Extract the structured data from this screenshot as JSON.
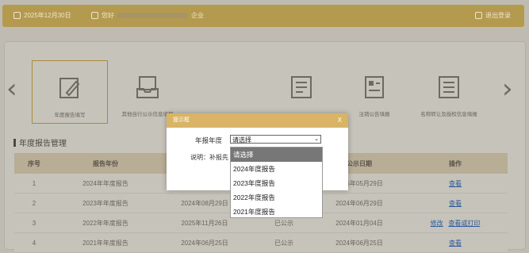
{
  "topbar": {
    "date": "2025年12月30日",
    "welcome": "您好",
    "suffix": "企业",
    "logout": "退出登录"
  },
  "tiles": [
    {
      "label": "年度报告填写"
    },
    {
      "label": "其他自行公示信息填报"
    },
    {
      "label": ""
    },
    {
      "label": "注销公告填报"
    },
    {
      "label": "名称转让及授权信息填报"
    }
  ],
  "section_title": "年度报告管理",
  "table": {
    "headers": [
      "序号",
      "报告年份",
      "",
      "",
      "公示日期",
      "操作"
    ],
    "rows": [
      {
        "num": "1",
        "year": "2024年年度报告",
        "date": "",
        "status": "",
        "pub": "2025年05月29日",
        "edit": "",
        "action": "查看"
      },
      {
        "num": "2",
        "year": "2023年年度报告",
        "date": "2024年08月29日",
        "status": "",
        "pub": "2024年06月29日",
        "edit": "",
        "action": "查看"
      },
      {
        "num": "3",
        "year": "2022年年度报告",
        "date": "2025年11月26日",
        "status": "已公示",
        "pub": "2024年01月04日",
        "edit": "修改",
        "action": "查看或打印"
      },
      {
        "num": "4",
        "year": "2021年年度报告",
        "date": "2024年06月25日",
        "status": "已公示",
        "pub": "2024年06月25日",
        "edit": "",
        "action": "查看"
      }
    ]
  },
  "dialog": {
    "title": "提示框",
    "close": "X",
    "year_label": "年报年度",
    "selected": "请选择",
    "note": "说明：补报先"
  },
  "dropdown": {
    "options": [
      "请选择",
      "2024年度报告",
      "2023年度报告",
      "2022年度报告",
      "2021年度报告"
    ]
  }
}
